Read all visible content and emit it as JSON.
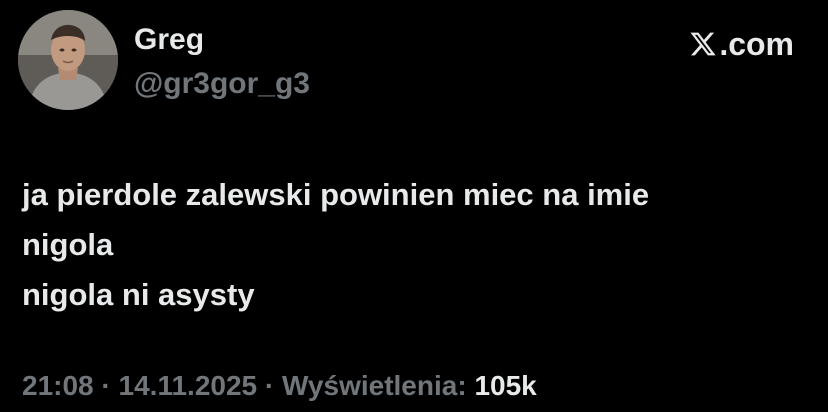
{
  "tweet": {
    "author": {
      "display_name": "Greg",
      "handle": "@gr3gor_g3"
    },
    "brand": {
      "logo_icon": "x-logo-icon",
      "domain": ".com"
    },
    "text": "ja pierdole zalewski powinien miec na imie\nnigola\nnigola ni asysty",
    "meta": {
      "time": "21:08",
      "separator": " · ",
      "date": "14.11.2025",
      "views_label": "Wyświetlenia:",
      "views_count": "105k"
    }
  },
  "colors": {
    "background": "#000000",
    "primary_text": "#e7e9ea",
    "secondary_text": "#71767b"
  }
}
